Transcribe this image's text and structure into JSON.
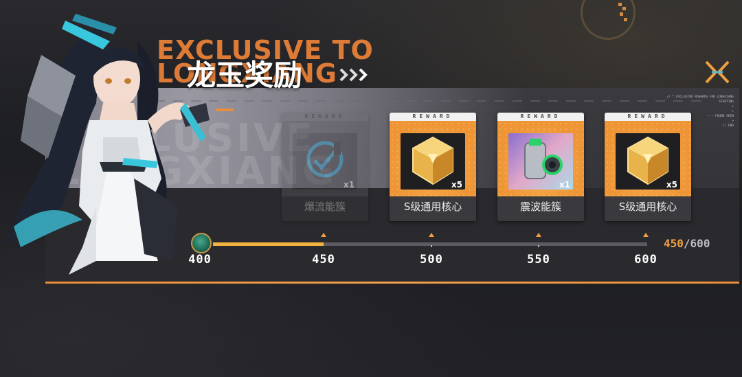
{
  "header": {
    "title_bg_en": "EXCLUSIVE TO\nLONGXIANG",
    "title_zh": "龙玉奖励",
    "close_icon": "close-x-icon",
    "watermark_text": "EXCLUSIVE\nLONGXIANG",
    "info_text": "// * EXCLUSIVE REWARDS FOR LONGXIANG\nSTARTING\n>\n>\n— — FOUND SKIN\n>\n// END"
  },
  "rewards": [
    {
      "tag": "REWARD",
      "name": "爆流能簇",
      "qty": "x1",
      "icon": "dark-energy-cluster-icon",
      "claimed": true
    },
    {
      "tag": "REWARD",
      "name": "S级通用核心",
      "qty": "x5",
      "icon": "golden-core-crystal-icon",
      "claimed": false
    },
    {
      "tag": "REWARD",
      "name": "震波能簇",
      "qty": "x1",
      "icon": "shockwave-energy-cluster-icon",
      "claimed": false
    },
    {
      "tag": "REWARD",
      "name": "S级通用核心",
      "qty": "x5",
      "icon": "golden-core-crystal-icon",
      "claimed": false
    }
  ],
  "progress": {
    "start_label": "400",
    "milestones": [
      "450",
      "500",
      "550",
      "600"
    ],
    "current": "450",
    "separator": "/",
    "max": "600",
    "current_value": 450,
    "min_value": 400,
    "max_value": 600,
    "coin_icon": "dragon-jade-coin-icon"
  },
  "colors": {
    "accent_orange": "#f0a040",
    "progress_fill": "#f2b33e",
    "panel_bg": "#2f2e33"
  }
}
